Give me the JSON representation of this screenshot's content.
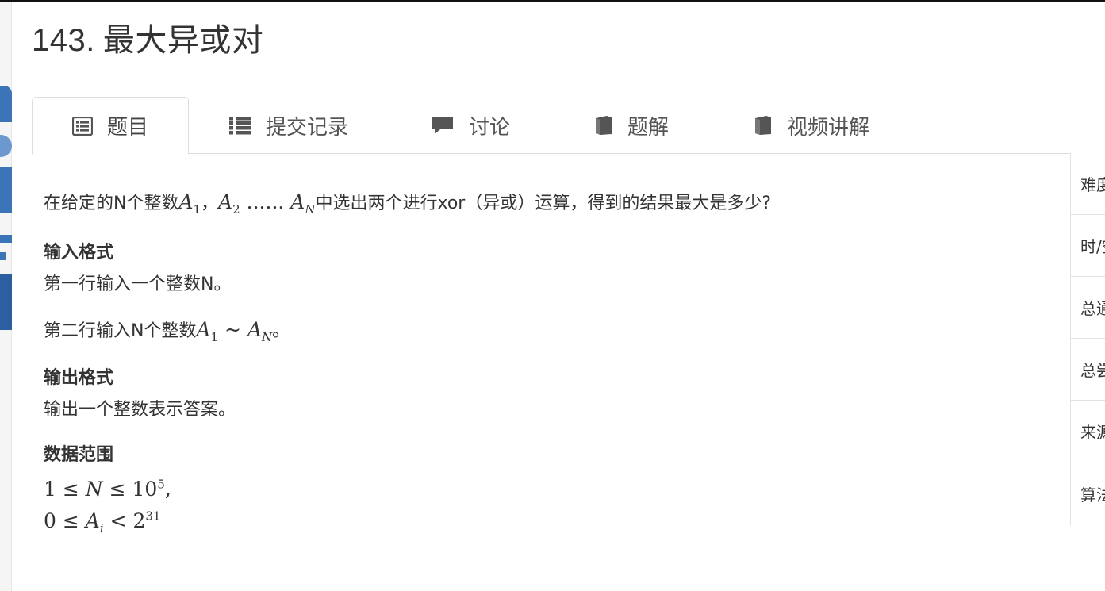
{
  "problem": {
    "number": "143.",
    "name": "最大异或对"
  },
  "tabs": [
    {
      "label": "题目",
      "icon": "list-alt-icon",
      "active": true
    },
    {
      "label": "提交记录",
      "icon": "list-icon",
      "active": false
    },
    {
      "label": "讨论",
      "icon": "comment-icon",
      "active": false
    },
    {
      "label": "题解",
      "icon": "book-icon",
      "active": false
    },
    {
      "label": "视频讲解",
      "icon": "book-icon",
      "active": false
    }
  ],
  "description": {
    "text_before": "在给定的N个整数",
    "a": "A",
    "sub_1": "1",
    "comma": "，",
    "sub_2": "2",
    "dots": "......",
    "sub_n": "N",
    "text_after": "中选出两个进行xor（异或）运算，得到的结果最大是多少?"
  },
  "input_format": {
    "heading": "输入格式",
    "line1": "第一行输入一个整数N。",
    "line2_before": "第二行输入N个整数",
    "tilde": "~",
    "line2_after": "。"
  },
  "output_format": {
    "heading": "输出格式",
    "line": "输出一个整数表示答案。"
  },
  "data_range": {
    "heading": "数据范围",
    "r1_one": "1",
    "le": "≤",
    "N": "N",
    "ten": "10",
    "exp5": "5",
    "r1_comma": ",",
    "r2_zero": "0",
    "A": "A",
    "i": "i",
    "lt": "<",
    "two": "2",
    "exp31": "31"
  },
  "sidebar": {
    "items": [
      "难度",
      "时/空",
      "总通过",
      "总尝试",
      "来源",
      "算法"
    ]
  },
  "colors": {
    "text": "#333333",
    "border": "#dddddd",
    "icon": "#555555",
    "left_art": "#3b74b7"
  }
}
